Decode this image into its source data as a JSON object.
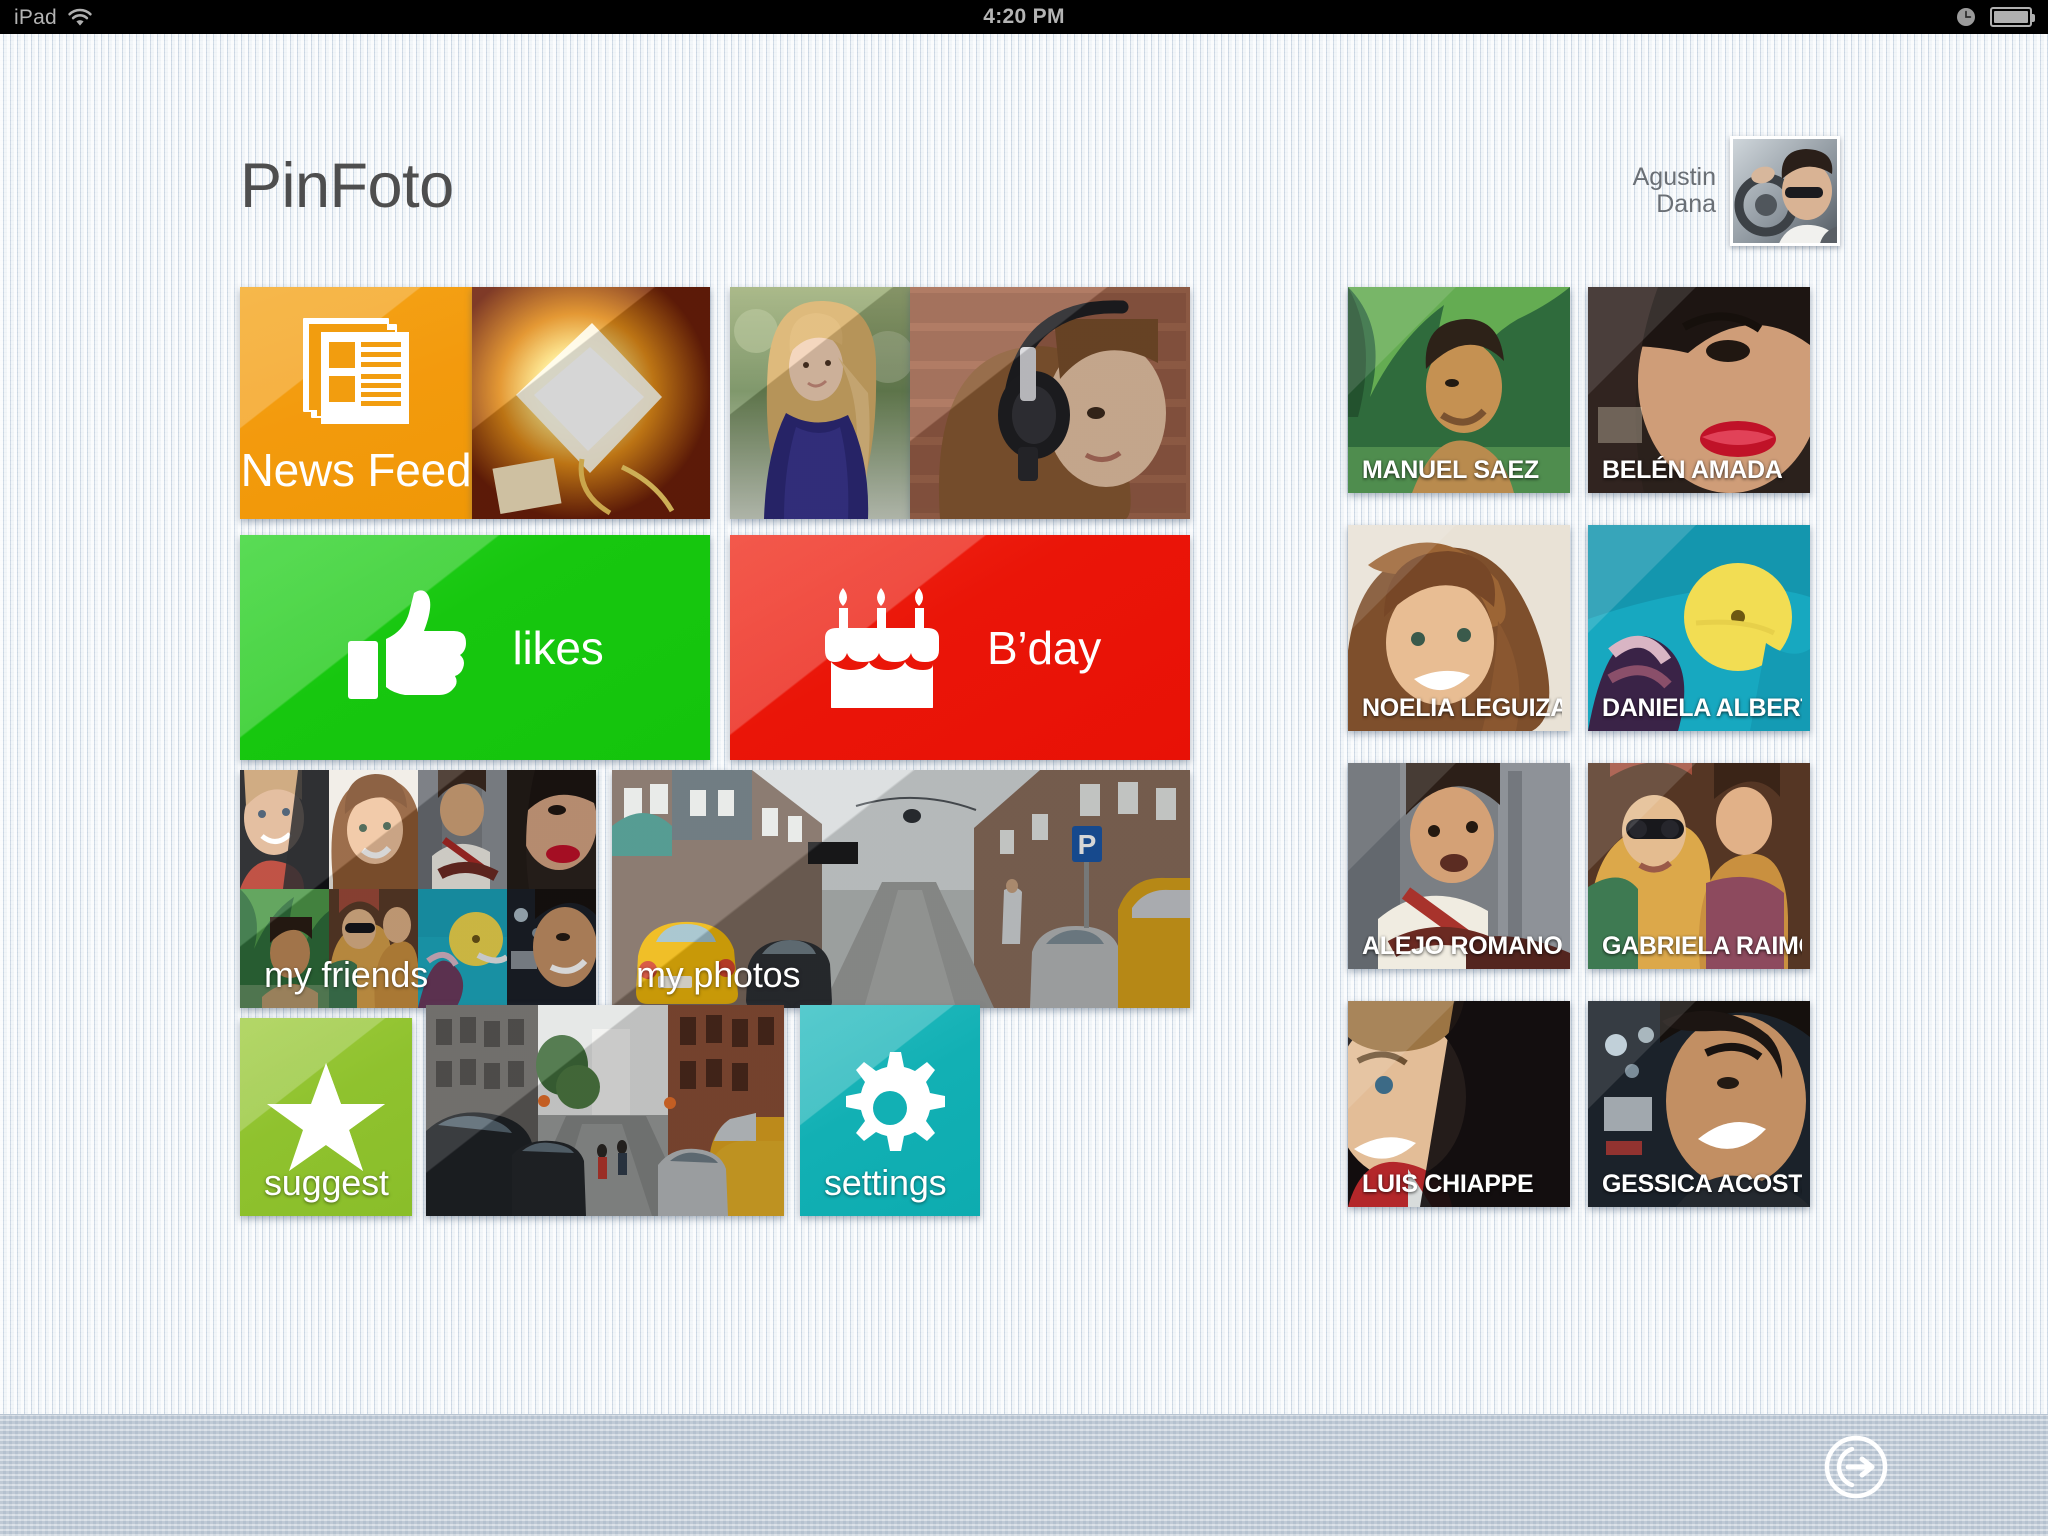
{
  "statusbar": {
    "device_label": "iPad",
    "time": "4:20 PM",
    "wifi_icon": "wifi-icon",
    "clock_icon": "clock-icon",
    "battery_icon": "battery-icon"
  },
  "header": {
    "app_title": "PinFoto",
    "user_name": "Agustin\nDana",
    "avatar_icon": "user-avatar-photo"
  },
  "tiles": [
    {
      "id": "news-feed",
      "label": "News Feed",
      "kind": "icon",
      "icon": "newspaper-icon",
      "color": "#f39a0d"
    },
    {
      "id": "photo-lamp",
      "label": "",
      "kind": "photo",
      "icon": "photo-lamp"
    },
    {
      "id": "photo-blonde",
      "label": "",
      "kind": "photo",
      "icon": "photo-blonde-woman"
    },
    {
      "id": "photo-headphones",
      "label": "",
      "kind": "photo",
      "icon": "photo-headphones-woman"
    },
    {
      "id": "likes",
      "label": "likes",
      "kind": "icon",
      "icon": "thumbs-up-icon",
      "color": "#17c70f"
    },
    {
      "id": "bday",
      "label": "B’day",
      "kind": "icon",
      "icon": "birthday-cake-icon",
      "color": "#ea1508"
    },
    {
      "id": "my-friends",
      "label": "my friends",
      "kind": "collage",
      "icon": "friends-collage"
    },
    {
      "id": "my-photos",
      "label": "my photos",
      "kind": "photo",
      "icon": "photo-amsterdam-street"
    },
    {
      "id": "suggest",
      "label": "suggest",
      "kind": "icon",
      "icon": "star-icon",
      "color": "#8fc22e"
    },
    {
      "id": "street-photo",
      "label": "",
      "kind": "photo",
      "icon": "photo-city-street"
    },
    {
      "id": "settings",
      "label": "settings",
      "kind": "icon",
      "icon": "gear-icon",
      "color": "#12b0b4"
    }
  ],
  "contacts": [
    {
      "name": "MANUEL SAEZ",
      "avatar": "photo-manuel"
    },
    {
      "name": "BELÉN AMADA",
      "avatar": "photo-belen"
    },
    {
      "name": "NOELIA LEGUIZA...",
      "avatar": "photo-noelia"
    },
    {
      "name": "DANIELA ALBERT",
      "avatar": "photo-daniela"
    },
    {
      "name": "ALEJO ROMANO",
      "avatar": "photo-alejo"
    },
    {
      "name": "GABRIELA RAIMO...",
      "avatar": "photo-gabriela"
    },
    {
      "name": "LUIS CHIAPPE",
      "avatar": "photo-luis"
    },
    {
      "name": "GESSICA ACOSTA",
      "avatar": "photo-gessica"
    }
  ],
  "bottombar": {
    "logout_icon": "logout-icon"
  },
  "colors": {
    "news_feed": "#f39a0d",
    "likes": "#17c70f",
    "bday": "#ea1508",
    "suggest": "#8fc22e",
    "settings": "#12b0b4",
    "background": "#e3eaf1",
    "bottom_bar": "#c3ceda",
    "title_text": "#4e4e4e"
  }
}
